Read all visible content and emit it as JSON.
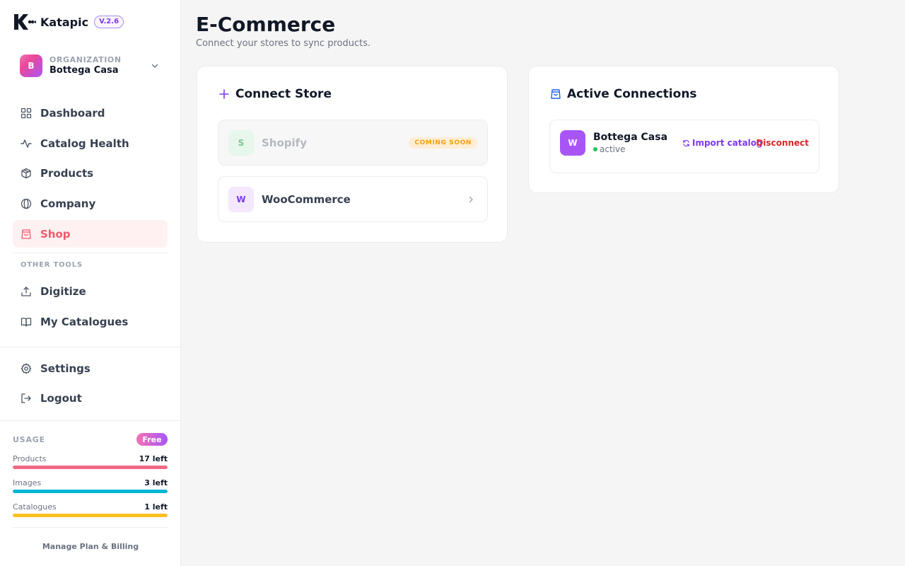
{
  "brand": {
    "name": "Katapic",
    "version": "V.2.6"
  },
  "organization": {
    "caption": "ORGANIZATION",
    "name": "Bottega Casa",
    "initial": "B"
  },
  "nav": {
    "main": [
      {
        "label": "Dashboard",
        "icon": "grid-icon"
      },
      {
        "label": "Catalog Health",
        "icon": "activity-icon"
      },
      {
        "label": "Products",
        "icon": "box-icon"
      },
      {
        "label": "Company",
        "icon": "globe-icon"
      },
      {
        "label": "Shop",
        "icon": "shopping-bag-icon",
        "active": true
      }
    ],
    "other_caption": "OTHER TOOLS",
    "other": [
      {
        "label": "Digitize",
        "icon": "upload-icon"
      },
      {
        "label": "My Catalogues",
        "icon": "book-open-icon"
      }
    ],
    "bottom": [
      {
        "label": "Settings",
        "icon": "gear-icon"
      },
      {
        "label": "Logout",
        "icon": "logout-icon"
      }
    ]
  },
  "usage": {
    "title": "USAGE",
    "plan": "Free",
    "rows": [
      {
        "label": "Products",
        "value": "17 left",
        "fill": 1.0,
        "color": "#f06a84"
      },
      {
        "label": "Images",
        "value": "3 left",
        "fill": 1.0,
        "color": "#06b6d4"
      },
      {
        "label": "Catalogues",
        "value": "1 left",
        "fill": 1.0,
        "color": "#fbbf24"
      }
    ],
    "billing_link": "Manage Plan & Billing"
  },
  "main": {
    "title": "E-Commerce",
    "subtitle": "Connect your stores to sync products.",
    "connect_card": {
      "title": "Connect Store",
      "stores": [
        {
          "initial": "S",
          "name": "Shopify",
          "badge": "COMING SOON",
          "disabled": true
        },
        {
          "initial": "W",
          "name": "WooCommerce",
          "disabled": false
        }
      ]
    },
    "active_card": {
      "title": "Active Connections",
      "connection": {
        "initial": "W",
        "name": "Bottega Casa",
        "status": "active",
        "import_label": "Import catalog",
        "disconnect_label": "Disconnect"
      }
    }
  },
  "colors": {
    "accent": "#f05a6c",
    "purple": "#7c3aed",
    "danger": "#dc2626",
    "success": "#22c55e"
  }
}
